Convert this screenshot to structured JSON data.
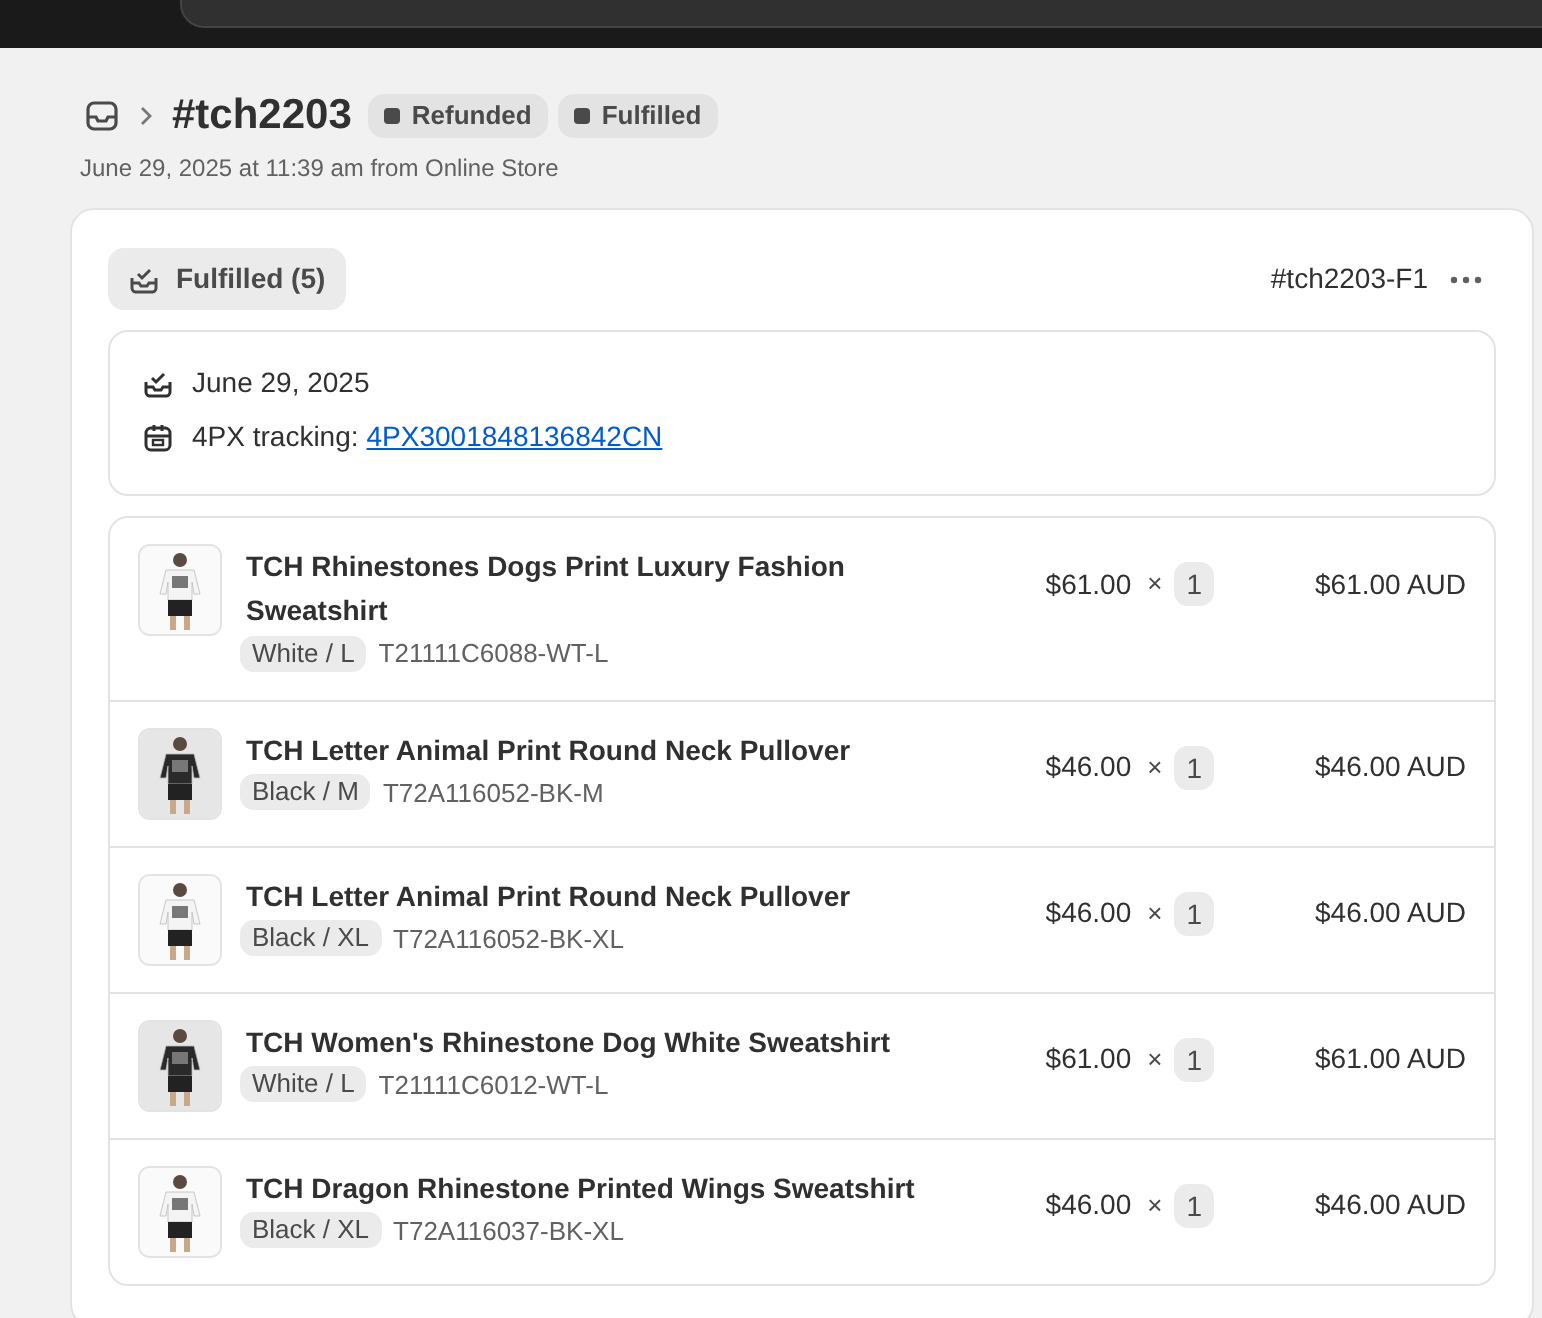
{
  "header": {
    "title": "#tch2203",
    "badges": [
      {
        "label": "Refunded"
      },
      {
        "label": "Fulfilled"
      }
    ],
    "subtitle": "June 29, 2025 at 11:39 am from Online Store"
  },
  "fulfillment": {
    "status": "Fulfilled (5)",
    "id": "#tch2203-F1",
    "date": "June 29, 2025",
    "tracking_label": "4PX tracking:",
    "tracking_number": "4PX3001848136842CN",
    "items": [
      {
        "name": "TCH Rhinestones Dogs Print Luxury Fashion Sweatshirt",
        "variant": "White / L",
        "sku": "T21111C6088-WT-L",
        "price": "$61.00",
        "times": "×",
        "quantity": "1",
        "total": "$61.00 AUD"
      },
      {
        "name": "TCH Letter Animal Print Round Neck Pullover",
        "variant": "Black / M",
        "sku": "T72A116052-BK-M",
        "price": "$46.00",
        "times": "×",
        "quantity": "1",
        "total": "$46.00 AUD"
      },
      {
        "name": "TCH Letter Animal Print Round Neck Pullover",
        "variant": "Black / XL",
        "sku": "T72A116052-BK-XL",
        "price": "$46.00",
        "times": "×",
        "quantity": "1",
        "total": "$46.00 AUD"
      },
      {
        "name": "TCH Women's Rhinestone Dog White Sweatshirt",
        "variant": "White / L",
        "sku": "T21111C6012-WT-L",
        "price": "$61.00",
        "times": "×",
        "quantity": "1",
        "total": "$61.00 AUD"
      },
      {
        "name": "TCH Dragon Rhinestone Printed Wings Sweatshirt",
        "variant": "Black / XL",
        "sku": "T72A116037-BK-XL",
        "price": "$46.00",
        "times": "×",
        "quantity": "1",
        "total": "$46.00 AUD"
      }
    ]
  }
}
